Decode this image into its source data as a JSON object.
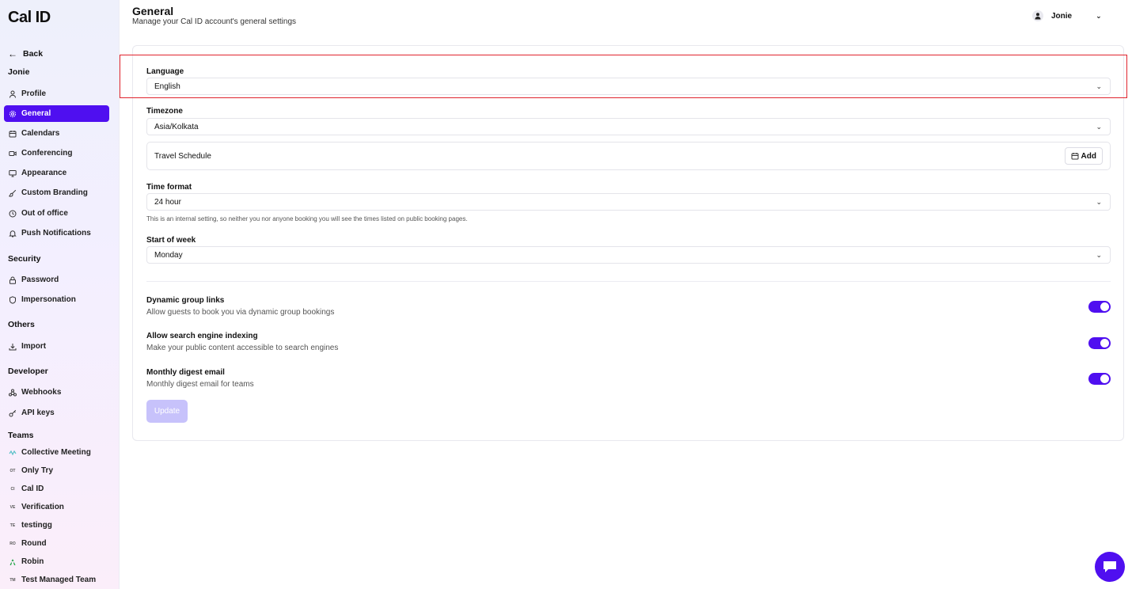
{
  "app": {
    "logo": "Cal ID"
  },
  "sidebar": {
    "back_label": "Back",
    "user_section": "Jonie",
    "items": [
      {
        "label": "Profile",
        "icon": "user-icon"
      },
      {
        "label": "General",
        "icon": "gear-icon",
        "active": true
      },
      {
        "label": "Calendars",
        "icon": "calendar-icon"
      },
      {
        "label": "Conferencing",
        "icon": "video-icon"
      },
      {
        "label": "Appearance",
        "icon": "monitor-icon"
      },
      {
        "label": "Custom Branding",
        "icon": "brush-icon"
      },
      {
        "label": "Out of office",
        "icon": "clock-icon"
      },
      {
        "label": "Push Notifications",
        "icon": "bell-icon"
      }
    ],
    "security_section": "Security",
    "security_items": [
      {
        "label": "Password",
        "icon": "lock-icon"
      },
      {
        "label": "Impersonation",
        "icon": "shield-icon"
      }
    ],
    "others_section": "Others",
    "others_items": [
      {
        "label": "Import",
        "icon": "download-icon"
      }
    ],
    "developer_section": "Developer",
    "developer_items": [
      {
        "label": "Webhooks",
        "icon": "webhook-icon"
      },
      {
        "label": "API keys",
        "icon": "key-icon"
      }
    ],
    "teams_section": "Teams",
    "teams": [
      {
        "label": "Collective Meeting",
        "icon": "team-logo-icon"
      },
      {
        "label": "Only Try",
        "icon": "team-initials-icon",
        "initials": "OT"
      },
      {
        "label": "Cal ID",
        "icon": "team-initials-icon",
        "initials": "CI"
      },
      {
        "label": "Verification",
        "icon": "team-initials-icon",
        "initials": "VE"
      },
      {
        "label": "testingg",
        "icon": "team-initials-icon",
        "initials": "TE"
      },
      {
        "label": "Round",
        "icon": "team-initials-icon",
        "initials": "RO"
      },
      {
        "label": "Robin",
        "icon": "team-logo-icon"
      },
      {
        "label": "Test Managed Team",
        "icon": "team-initials-icon",
        "initials": "TM"
      }
    ]
  },
  "header": {
    "title": "General",
    "subtitle": "Manage your Cal ID account's general settings",
    "user_name": "Jonie"
  },
  "form": {
    "language_label": "Language",
    "language_value": "English",
    "timezone_label": "Timezone",
    "timezone_value": "Asia/Kolkata",
    "travel_schedule_label": "Travel Schedule",
    "add_label": "Add",
    "time_format_label": "Time format",
    "time_format_value": "24 hour",
    "time_format_hint": "This is an internal setting, so neither you nor anyone booking you will see the times listed on public booking pages.",
    "start_of_week_label": "Start of week",
    "start_of_week_value": "Monday",
    "toggles": [
      {
        "title": "Dynamic group links",
        "description": "Allow guests to book you via dynamic group bookings",
        "enabled": true
      },
      {
        "title": "Allow search engine indexing",
        "description": "Make your public content accessible to search engines",
        "enabled": true
      },
      {
        "title": "Monthly digest email",
        "description": "Monthly digest email for teams",
        "enabled": true
      }
    ],
    "update_label": "Update"
  },
  "colors": {
    "accent": "#4f0ff0",
    "highlight": "#e0242e",
    "update_disabled": "#c7c2fb"
  }
}
